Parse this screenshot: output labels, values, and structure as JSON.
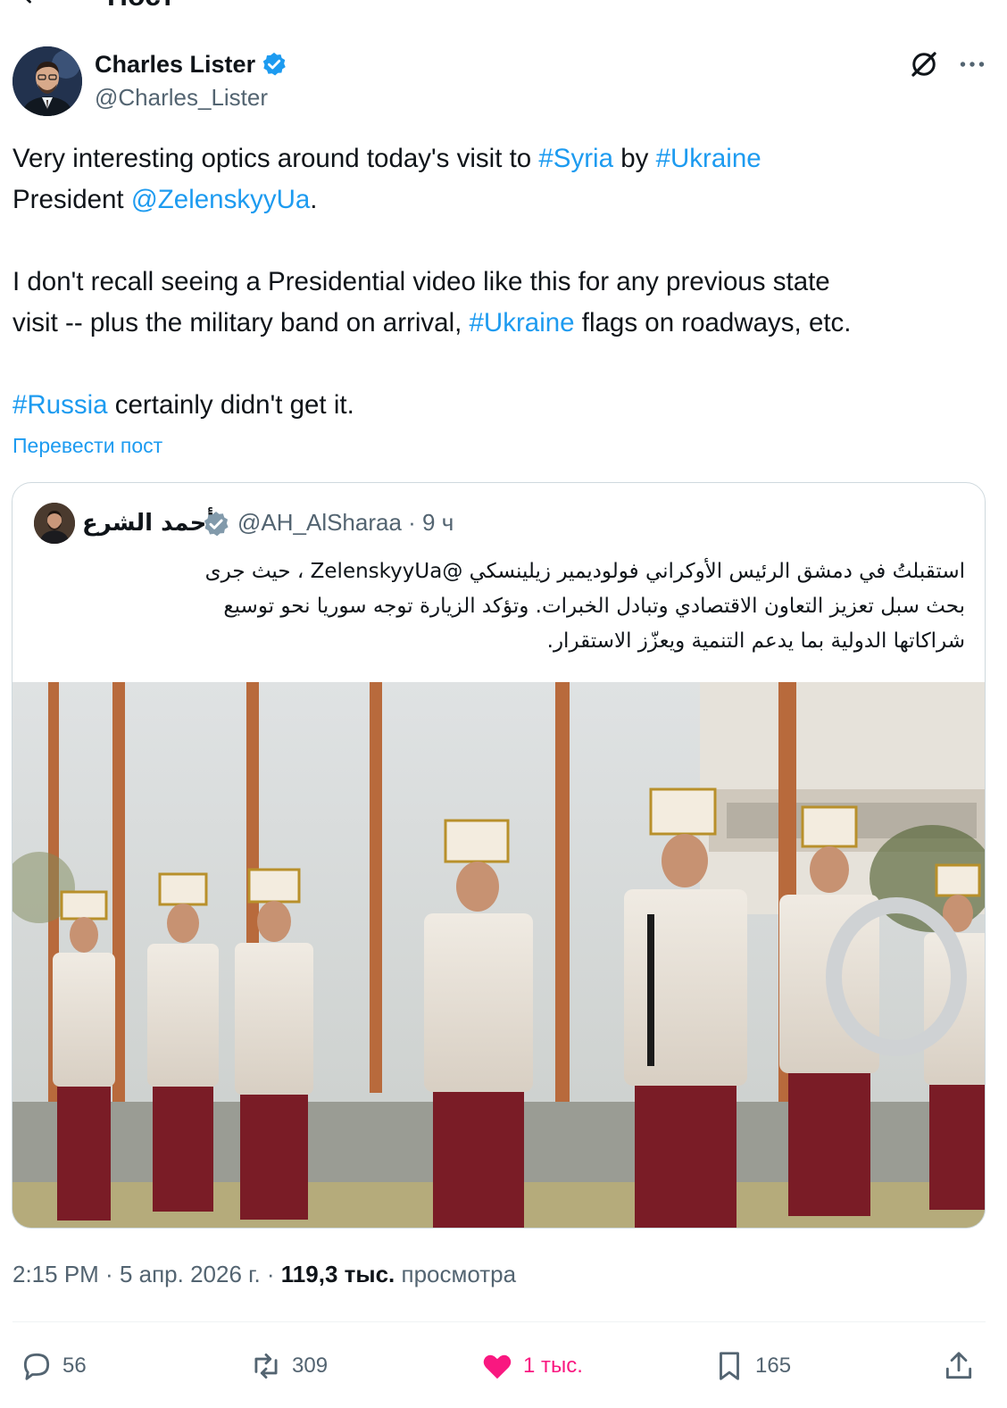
{
  "header": {
    "title": "Пост"
  },
  "author": {
    "name": "Charles Lister",
    "handle": "@Charles_Lister"
  },
  "post": {
    "line1": {
      "a": "Very interesting optics around today's visit to ",
      "tag1": "#Syria",
      "b": " by ",
      "tag2": "#Ukraine"
    },
    "line2": {
      "a": "President ",
      "mention": "@ZelenskyyUa",
      "b": "."
    },
    "line3": "I don't recall seeing a Presidential video like this for any previous state",
    "line4": {
      "a": "visit -- plus the military band on arrival, ",
      "tag": "#Ukraine",
      "b": " flags on roadways, etc."
    },
    "line5": {
      "tag": "#Russia",
      "b": " certainly didn't get it."
    },
    "translate": "Перевести пост"
  },
  "quote": {
    "name": "أحمد الشرع",
    "handle": "@AH_AlSharaa · 9 ч",
    "text_line1": "استقبلتُ في دمشق الرئيس الأوكراني فولوديمير زيلينسكي @ZelenskyyUa ، حيث جرى",
    "text_line2": "بحث سبل تعزيز التعاون الاقتصادي وتبادل الخبرات. وتؤكد الزيارة توجه سوريا نحو توسيع",
    "text_line3": "شراكاتها الدولية بما يدعم التنمية ويعزّز الاستقرار."
  },
  "meta": {
    "time": "2:15 PM",
    "sep1": " · ",
    "date": "5 апр. 2026 г.",
    "sep2": " · ",
    "views": "119,3 тыс.",
    "views_label": " просмотра"
  },
  "actions": {
    "replies": "56",
    "reposts": "309",
    "likes": "1 тыс.",
    "bookmarks": "165"
  },
  "colors": {
    "accent": "#1d9bf0",
    "like": "#f91880",
    "muted": "#536471"
  }
}
